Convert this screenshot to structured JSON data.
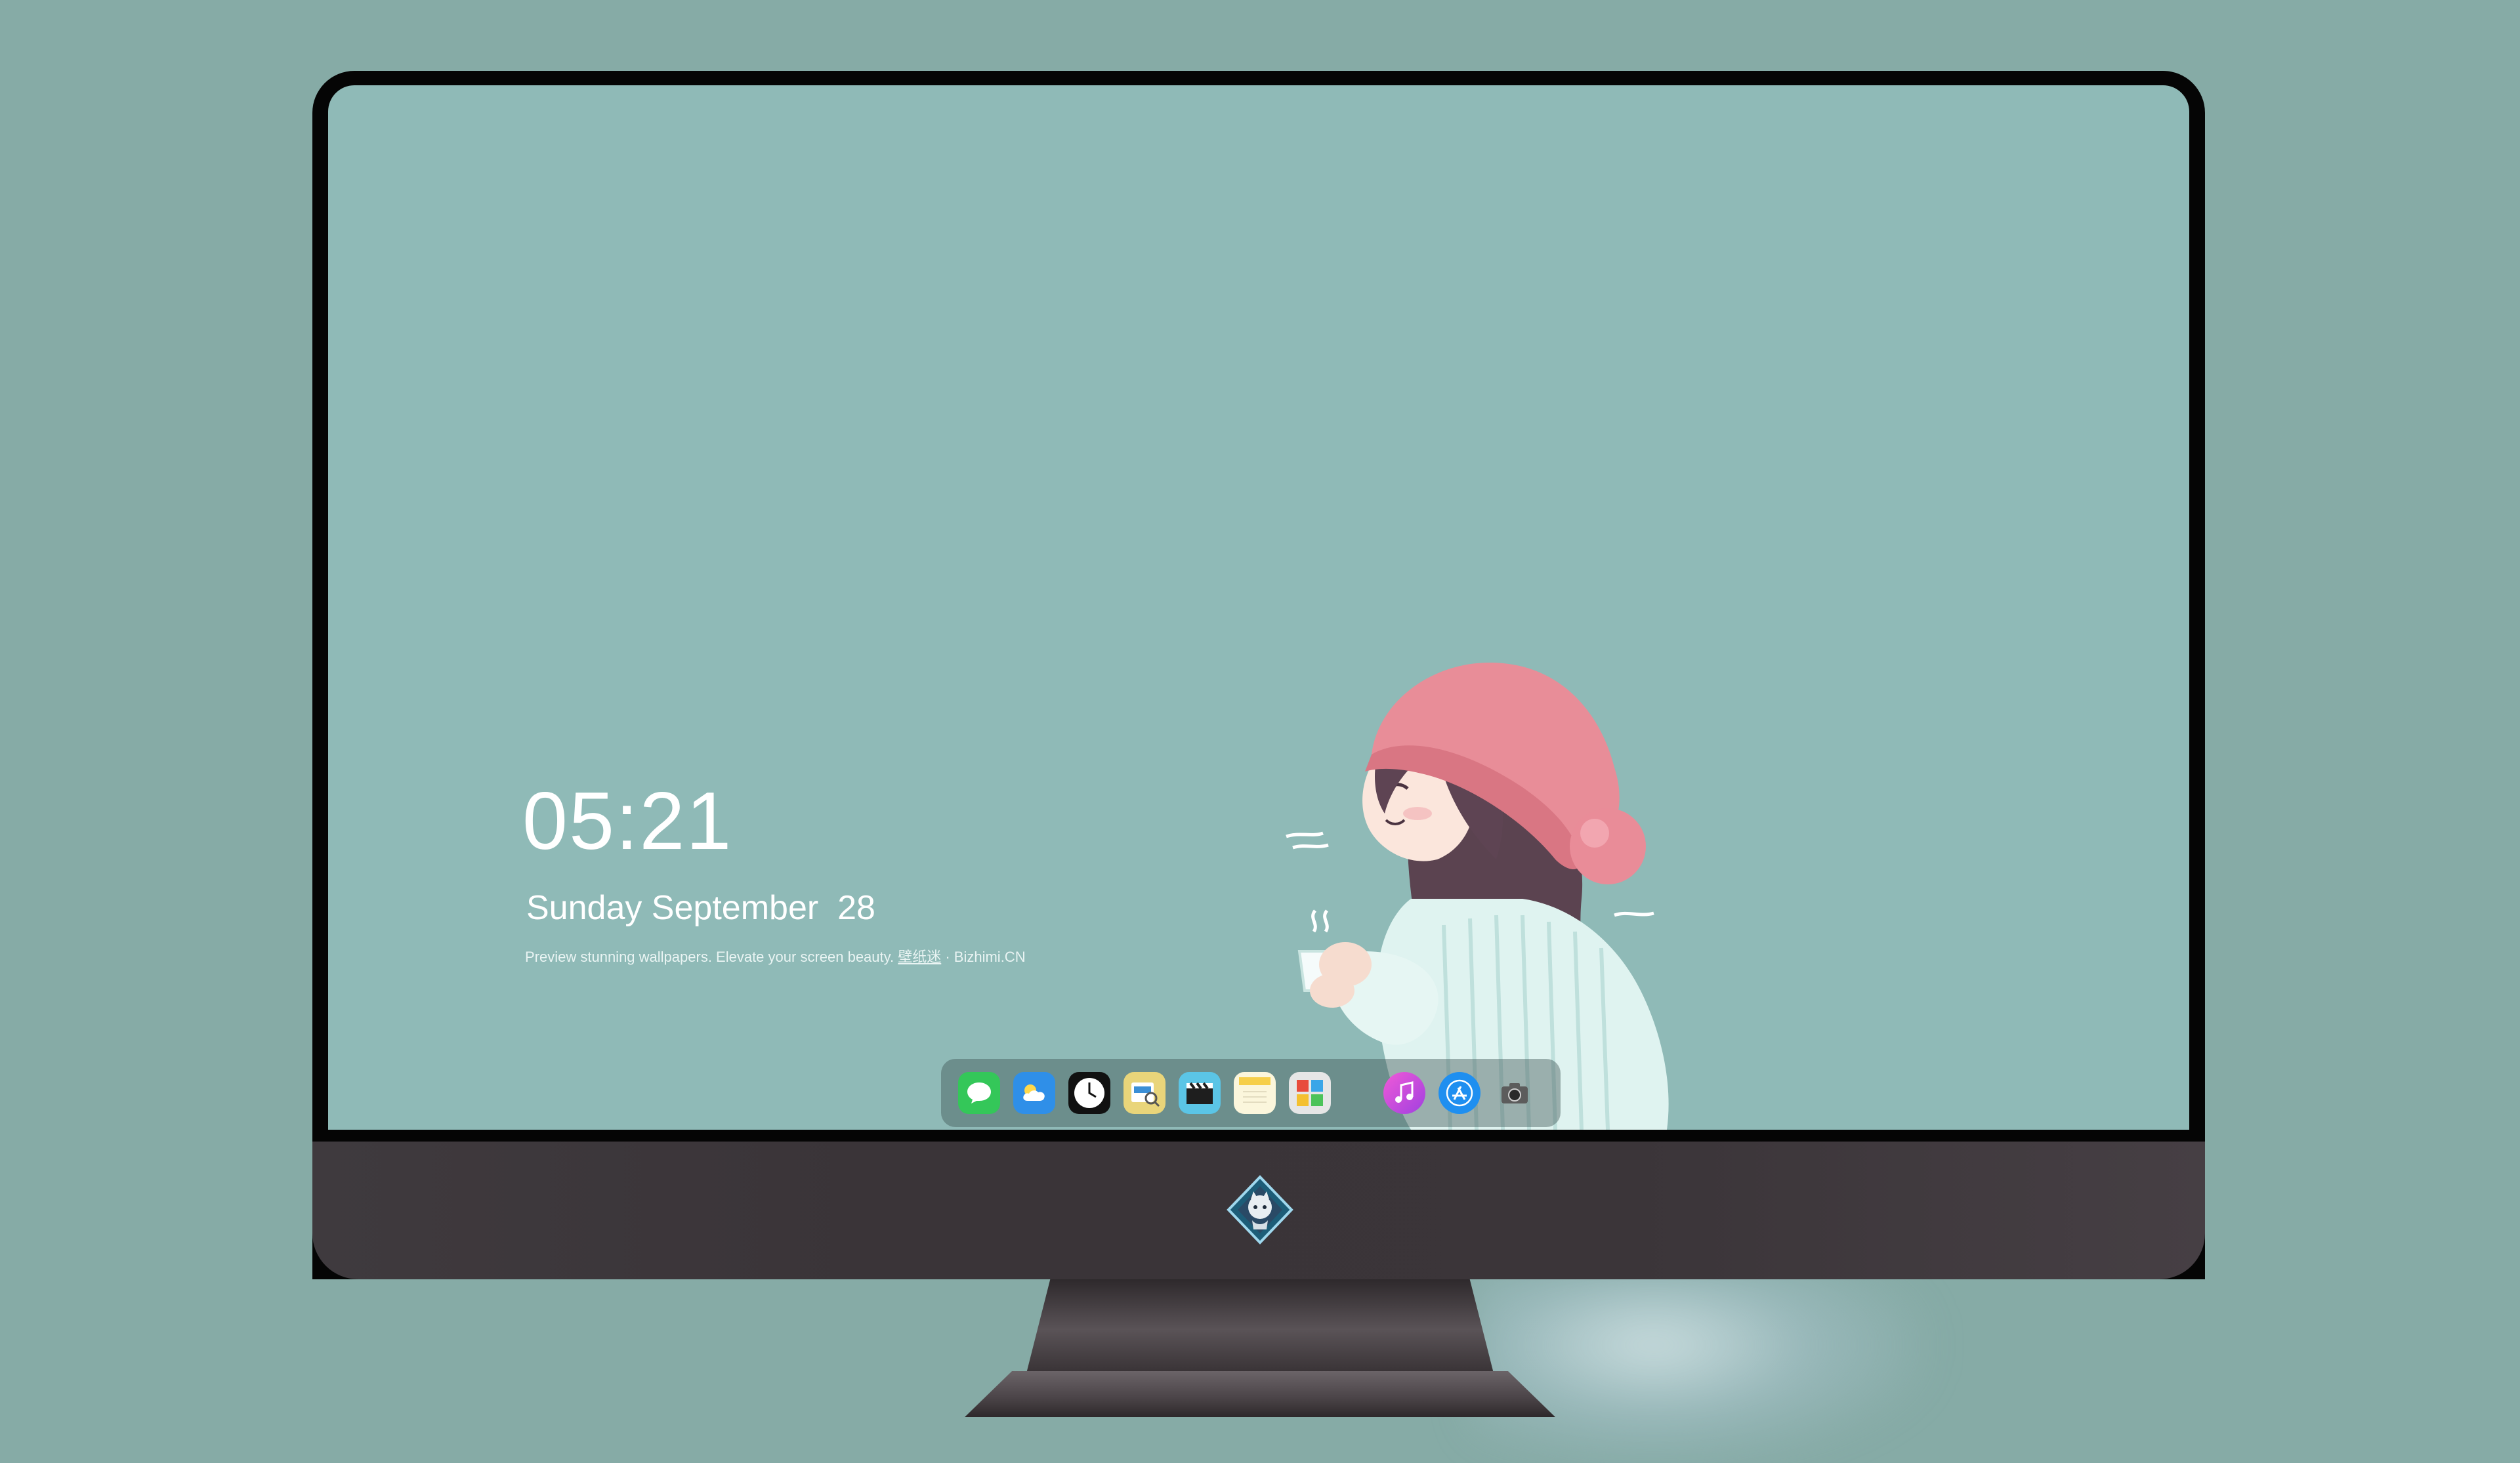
{
  "lockscreen": {
    "time": "05:21",
    "date": "Sunday September  28",
    "tagline": "Preview stunning wallpapers. Elevate your screen beauty. ",
    "tagline_brand": "壁纸迷",
    "tagline_site": " · Bizhimi.CN"
  },
  "dock": {
    "apps": [
      {
        "icon": "messages-icon",
        "color": "#34c759"
      },
      {
        "icon": "weather-icon",
        "color": "#2f8fe8"
      },
      {
        "icon": "clock-icon",
        "color": "#111111"
      },
      {
        "icon": "preview-icon",
        "color": "#e9d57a"
      },
      {
        "icon": "video-editor-icon",
        "color": "#5bc5e6"
      },
      {
        "icon": "notes-icon",
        "color": "#f6cf4a"
      },
      {
        "icon": "photo-collage-icon",
        "color": "#e6e6e6"
      },
      {
        "icon": "music-icon",
        "color": "#d14ad6"
      },
      {
        "icon": "app-store-icon",
        "color": "#1f8ff0"
      },
      {
        "icon": "camera-icon",
        "color": "#7a7a7a"
      }
    ]
  },
  "colors": {
    "background": "#86aba6",
    "wallpaper": "#8fbab7",
    "bezel": "#050505",
    "chin": "#3b3539"
  }
}
